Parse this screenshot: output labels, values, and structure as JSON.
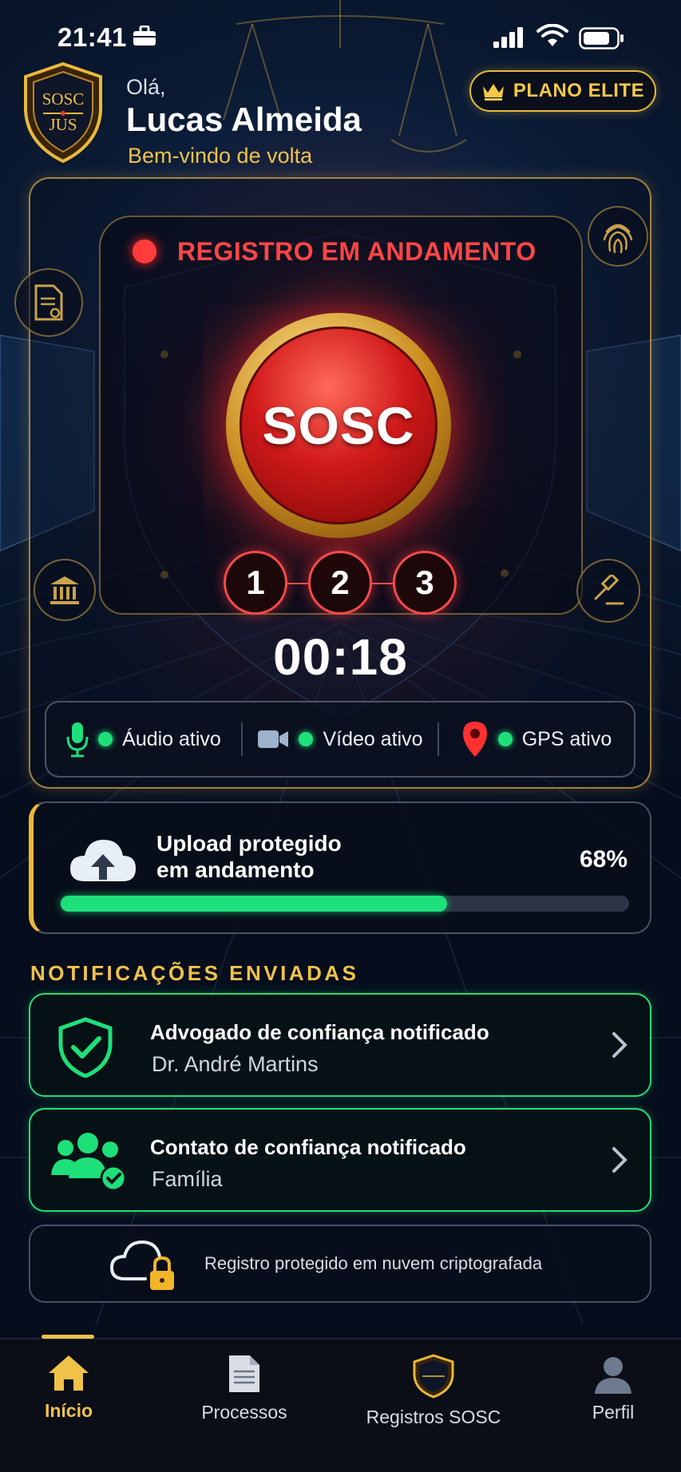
{
  "status_bar": {
    "time": "21:41"
  },
  "header": {
    "greeting": "Olá,",
    "user_name": "Lucas Almeida",
    "welcome": "Bem-vindo de volta",
    "plan_badge": "PLANO ELITE",
    "logo_text_top": "SOSC",
    "logo_text_bottom": "JUS"
  },
  "recording": {
    "status": "REGISTRO EM ANDAMENTO",
    "button_label": "SOSC",
    "steps": [
      "1",
      "2",
      "3"
    ],
    "timer": "00:18"
  },
  "sensors": [
    {
      "label": "Áudio ativo",
      "icon": "microphone-icon"
    },
    {
      "label": "Vídeo ativo",
      "icon": "video-camera-icon"
    },
    {
      "label": "GPS ativo",
      "icon": "location-pin-icon"
    }
  ],
  "upload": {
    "title_line1": "Upload protegido",
    "title_line2": "em andamento",
    "percent_label": "68%",
    "progress": 0.68
  },
  "notifications": {
    "section_title": "NOTIFICAÇÕES ENVIADAS",
    "items": [
      {
        "title": "Advogado de confiança notificado",
        "subtitle": "Dr. André Martins",
        "icon": "shield-check-icon"
      },
      {
        "title": "Contato de confiança notificado",
        "subtitle": "Família",
        "icon": "group-check-icon"
      }
    ]
  },
  "cloud_notice": "Registro protegido em nuvem criptografada",
  "nav": {
    "items": [
      {
        "label": "Início",
        "icon": "home-icon",
        "active": true
      },
      {
        "label": "Processos",
        "icon": "document-icon",
        "active": false
      },
      {
        "label": "Registros SOSC",
        "icon": "sosc-badge-icon",
        "active": false
      },
      {
        "label": "Perfil",
        "icon": "user-icon",
        "active": false
      }
    ]
  },
  "colors": {
    "gold": "#e9b93c",
    "alert_red": "#ff4646",
    "active_green": "#1ee07a",
    "background": "#0a1a33"
  }
}
